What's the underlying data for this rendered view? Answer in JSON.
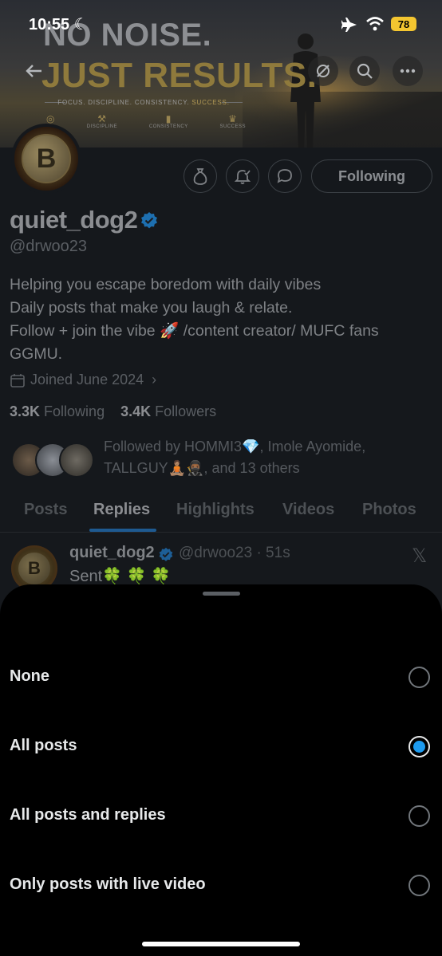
{
  "status_bar": {
    "time": "10:55",
    "battery": "78"
  },
  "banner": {
    "line1": "NO NOISE.",
    "line2": "JUST RESULTS.",
    "tagline_main": "FOCUS. DISCIPLINE. CONSISTENCY. ",
    "tagline_accent": "SUCCESS.",
    "icons": [
      {
        "label": "",
        "glyph": "◎"
      },
      {
        "label": "DISCIPLINE",
        "glyph": "⚒"
      },
      {
        "label": "CONSISTENCY",
        "glyph": "▮"
      },
      {
        "label": "SUCCESS",
        "glyph": "♛"
      }
    ]
  },
  "profile": {
    "name": "quiet_dog2",
    "handle": "@drwoo23",
    "following_button": "Following",
    "bio_lines": [
      "Helping you escape boredom with daily vibes",
      "Daily posts that make you laugh & relate.",
      "Follow + join the vibe 🚀  /content creator/ MUFC fans",
      "GGMU."
    ],
    "joined": "Joined June 2024",
    "following_count": "3.3K",
    "following_label": "Following",
    "followers_count": "3.4K",
    "followers_label": "Followers",
    "followed_by": "Followed by HOMMI3💎, Imole Ayomide, TALLGUY🧘🏽🥷🏾, and 13 others"
  },
  "tabs": [
    "Posts",
    "Replies",
    "Highlights",
    "Videos",
    "Photos"
  ],
  "active_tab": "Replies",
  "post": {
    "name": "quiet_dog2",
    "handle_time": "@drwoo23 · 51s",
    "text": "Sent🍀 🍀 🍀"
  },
  "sheet": {
    "options": [
      {
        "label": "None",
        "selected": false
      },
      {
        "label": "All posts",
        "selected": true
      },
      {
        "label": "All posts and replies",
        "selected": false
      },
      {
        "label": "Only posts with live video",
        "selected": false
      }
    ]
  },
  "colors": {
    "accent": "#1d9bf0",
    "battery": "#f4c630",
    "verified": "#1d9bf0"
  }
}
